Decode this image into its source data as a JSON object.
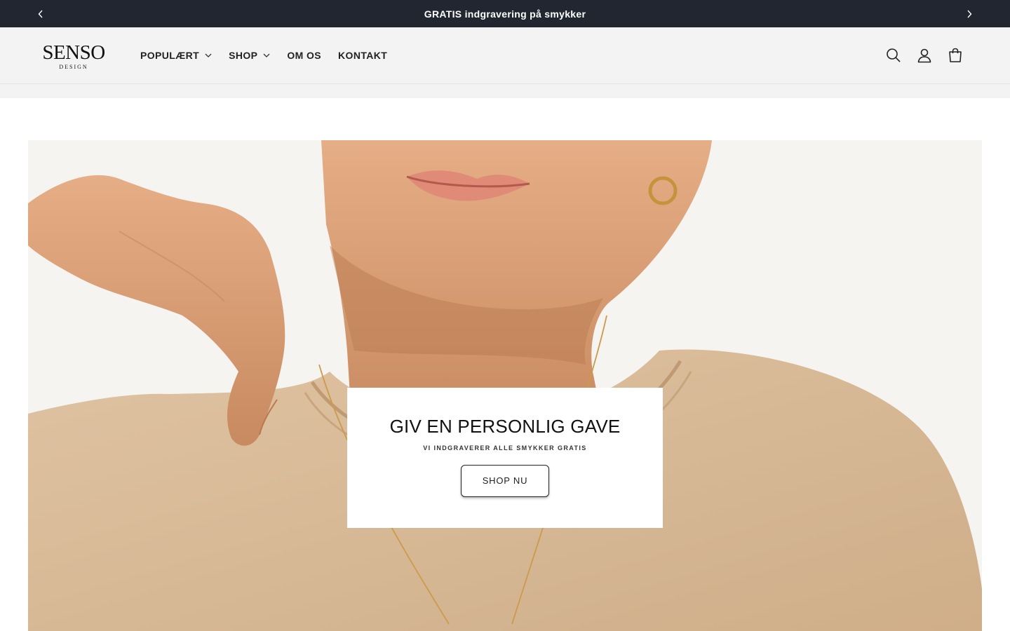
{
  "announcement": {
    "message": "GRATIS indgravering på smykker",
    "prev_icon": "chevron-left-icon",
    "next_icon": "chevron-right-icon"
  },
  "header": {
    "logo": {
      "brand": "SENSO",
      "sub": "DESIGN"
    },
    "nav": [
      {
        "label": "POPULÆRT",
        "has_dropdown": true
      },
      {
        "label": "SHOP",
        "has_dropdown": true
      },
      {
        "label": "OM OS",
        "has_dropdown": false
      },
      {
        "label": "KONTAKT",
        "has_dropdown": false
      }
    ],
    "icons": [
      "search-icon",
      "account-icon",
      "cart-icon"
    ]
  },
  "hero": {
    "title": "GIV EN PERSONLIG GAVE",
    "subtitle": "VI INDGRAVERER ALLE SMYKKER GRATIS",
    "button_label": "SHOP NU"
  },
  "colors": {
    "announcement_bg": "#222631",
    "header_bg": "#f3f3f3",
    "text": "#121212",
    "shirt": "#d8b894",
    "skin": "#e0a67c"
  }
}
